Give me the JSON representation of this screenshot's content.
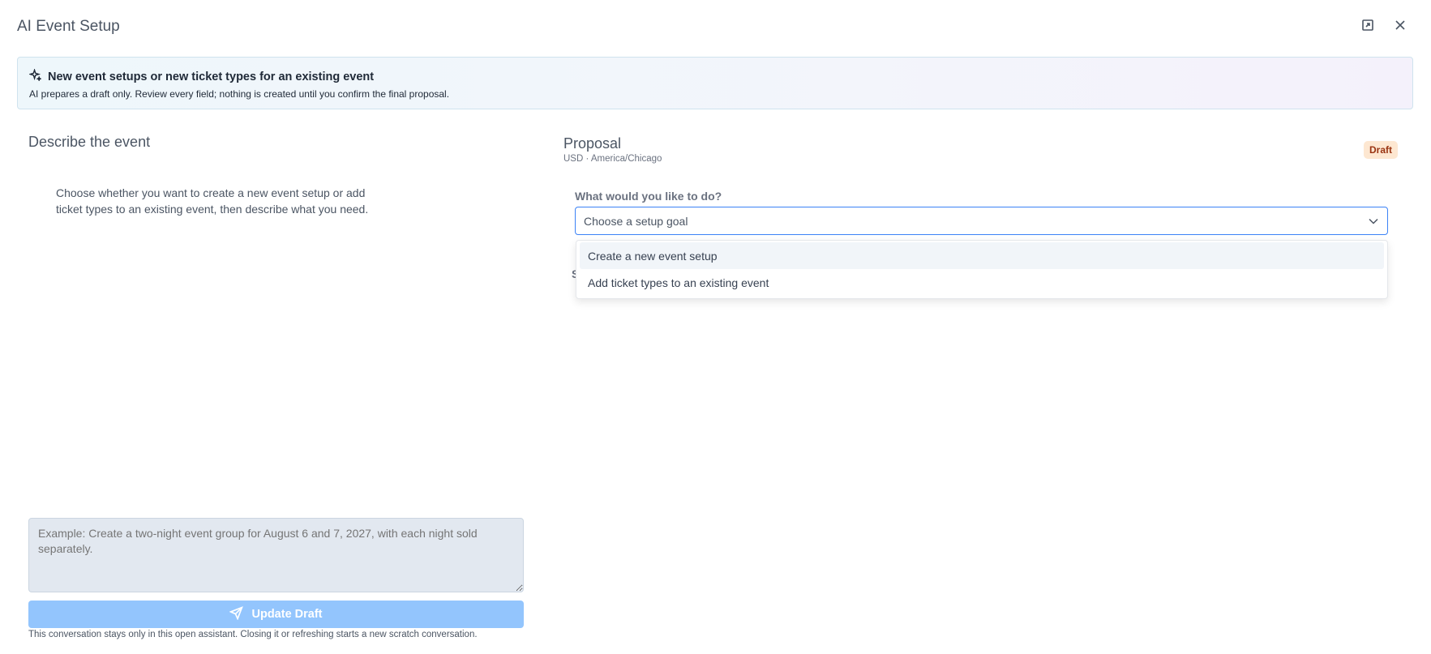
{
  "window": {
    "title": "AI Event Setup",
    "expand_icon": "expand-icon",
    "close_icon": "close-icon"
  },
  "banner": {
    "icon": "sparkles-icon",
    "title": "New event setups or new ticket types for an existing event",
    "subtitle": "AI prepares a draft only. Review every field; nothing is created until you confirm the final proposal."
  },
  "left": {
    "heading": "Describe the event",
    "intro": "Choose whether you want to create a new event setup or add ticket types to an existing event, then describe what you need.",
    "input_placeholder": "Example: Create a two-night event group for August 6 and 7, 2027, with each night sold separately.",
    "update_button": "Update Draft",
    "update_icon": "send-icon",
    "note": "This conversation stays only in this open assistant. Closing it or refreshing starts a new scratch conversation."
  },
  "proposal": {
    "title": "Proposal",
    "subtitle": "USD · America/Chicago",
    "badge": "Draft",
    "question": "What would you like to do?",
    "select_placeholder": "Choose a setup goal",
    "hidden_label": "S",
    "options": [
      "Create a new event setup",
      "Add ticket types to an existing event"
    ]
  },
  "colors": {
    "accent": "#3b82f6",
    "button_disabled": "#93c5fd",
    "badge_bg": "#fde7d1",
    "badge_text": "#9a3412"
  }
}
